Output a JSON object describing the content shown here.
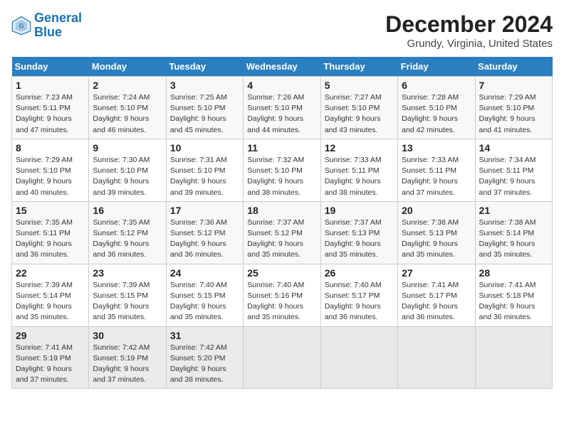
{
  "header": {
    "logo_line1": "General",
    "logo_line2": "Blue",
    "title": "December 2024",
    "subtitle": "Grundy, Virginia, United States"
  },
  "calendar": {
    "days_of_week": [
      "Sunday",
      "Monday",
      "Tuesday",
      "Wednesday",
      "Thursday",
      "Friday",
      "Saturday"
    ],
    "weeks": [
      [
        {
          "day": 1,
          "sunrise": "Sunrise: 7:23 AM",
          "sunset": "Sunset: 5:11 PM",
          "daylight": "Daylight: 9 hours and 47 minutes."
        },
        {
          "day": 2,
          "sunrise": "Sunrise: 7:24 AM",
          "sunset": "Sunset: 5:10 PM",
          "daylight": "Daylight: 9 hours and 46 minutes."
        },
        {
          "day": 3,
          "sunrise": "Sunrise: 7:25 AM",
          "sunset": "Sunset: 5:10 PM",
          "daylight": "Daylight: 9 hours and 45 minutes."
        },
        {
          "day": 4,
          "sunrise": "Sunrise: 7:26 AM",
          "sunset": "Sunset: 5:10 PM",
          "daylight": "Daylight: 9 hours and 44 minutes."
        },
        {
          "day": 5,
          "sunrise": "Sunrise: 7:27 AM",
          "sunset": "Sunset: 5:10 PM",
          "daylight": "Daylight: 9 hours and 43 minutes."
        },
        {
          "day": 6,
          "sunrise": "Sunrise: 7:28 AM",
          "sunset": "Sunset: 5:10 PM",
          "daylight": "Daylight: 9 hours and 42 minutes."
        },
        {
          "day": 7,
          "sunrise": "Sunrise: 7:29 AM",
          "sunset": "Sunset: 5:10 PM",
          "daylight": "Daylight: 9 hours and 41 minutes."
        }
      ],
      [
        {
          "day": 8,
          "sunrise": "Sunrise: 7:29 AM",
          "sunset": "Sunset: 5:10 PM",
          "daylight": "Daylight: 9 hours and 40 minutes."
        },
        {
          "day": 9,
          "sunrise": "Sunrise: 7:30 AM",
          "sunset": "Sunset: 5:10 PM",
          "daylight": "Daylight: 9 hours and 39 minutes."
        },
        {
          "day": 10,
          "sunrise": "Sunrise: 7:31 AM",
          "sunset": "Sunset: 5:10 PM",
          "daylight": "Daylight: 9 hours and 39 minutes."
        },
        {
          "day": 11,
          "sunrise": "Sunrise: 7:32 AM",
          "sunset": "Sunset: 5:10 PM",
          "daylight": "Daylight: 9 hours and 38 minutes."
        },
        {
          "day": 12,
          "sunrise": "Sunrise: 7:33 AM",
          "sunset": "Sunset: 5:11 PM",
          "daylight": "Daylight: 9 hours and 38 minutes."
        },
        {
          "day": 13,
          "sunrise": "Sunrise: 7:33 AM",
          "sunset": "Sunset: 5:11 PM",
          "daylight": "Daylight: 9 hours and 37 minutes."
        },
        {
          "day": 14,
          "sunrise": "Sunrise: 7:34 AM",
          "sunset": "Sunset: 5:11 PM",
          "daylight": "Daylight: 9 hours and 37 minutes."
        }
      ],
      [
        {
          "day": 15,
          "sunrise": "Sunrise: 7:35 AM",
          "sunset": "Sunset: 5:11 PM",
          "daylight": "Daylight: 9 hours and 36 minutes."
        },
        {
          "day": 16,
          "sunrise": "Sunrise: 7:35 AM",
          "sunset": "Sunset: 5:12 PM",
          "daylight": "Daylight: 9 hours and 36 minutes."
        },
        {
          "day": 17,
          "sunrise": "Sunrise: 7:36 AM",
          "sunset": "Sunset: 5:12 PM",
          "daylight": "Daylight: 9 hours and 36 minutes."
        },
        {
          "day": 18,
          "sunrise": "Sunrise: 7:37 AM",
          "sunset": "Sunset: 5:12 PM",
          "daylight": "Daylight: 9 hours and 35 minutes."
        },
        {
          "day": 19,
          "sunrise": "Sunrise: 7:37 AM",
          "sunset": "Sunset: 5:13 PM",
          "daylight": "Daylight: 9 hours and 35 minutes."
        },
        {
          "day": 20,
          "sunrise": "Sunrise: 7:38 AM",
          "sunset": "Sunset: 5:13 PM",
          "daylight": "Daylight: 9 hours and 35 minutes."
        },
        {
          "day": 21,
          "sunrise": "Sunrise: 7:38 AM",
          "sunset": "Sunset: 5:14 PM",
          "daylight": "Daylight: 9 hours and 35 minutes."
        }
      ],
      [
        {
          "day": 22,
          "sunrise": "Sunrise: 7:39 AM",
          "sunset": "Sunset: 5:14 PM",
          "daylight": "Daylight: 9 hours and 35 minutes."
        },
        {
          "day": 23,
          "sunrise": "Sunrise: 7:39 AM",
          "sunset": "Sunset: 5:15 PM",
          "daylight": "Daylight: 9 hours and 35 minutes."
        },
        {
          "day": 24,
          "sunrise": "Sunrise: 7:40 AM",
          "sunset": "Sunset: 5:15 PM",
          "daylight": "Daylight: 9 hours and 35 minutes."
        },
        {
          "day": 25,
          "sunrise": "Sunrise: 7:40 AM",
          "sunset": "Sunset: 5:16 PM",
          "daylight": "Daylight: 9 hours and 35 minutes."
        },
        {
          "day": 26,
          "sunrise": "Sunrise: 7:40 AM",
          "sunset": "Sunset: 5:17 PM",
          "daylight": "Daylight: 9 hours and 36 minutes."
        },
        {
          "day": 27,
          "sunrise": "Sunrise: 7:41 AM",
          "sunset": "Sunset: 5:17 PM",
          "daylight": "Daylight: 9 hours and 36 minutes."
        },
        {
          "day": 28,
          "sunrise": "Sunrise: 7:41 AM",
          "sunset": "Sunset: 5:18 PM",
          "daylight": "Daylight: 9 hours and 36 minutes."
        }
      ],
      [
        {
          "day": 29,
          "sunrise": "Sunrise: 7:41 AM",
          "sunset": "Sunset: 5:19 PM",
          "daylight": "Daylight: 9 hours and 37 minutes."
        },
        {
          "day": 30,
          "sunrise": "Sunrise: 7:42 AM",
          "sunset": "Sunset: 5:19 PM",
          "daylight": "Daylight: 9 hours and 37 minutes."
        },
        {
          "day": 31,
          "sunrise": "Sunrise: 7:42 AM",
          "sunset": "Sunset: 5:20 PM",
          "daylight": "Daylight: 9 hours and 38 minutes."
        },
        null,
        null,
        null,
        null
      ]
    ]
  }
}
